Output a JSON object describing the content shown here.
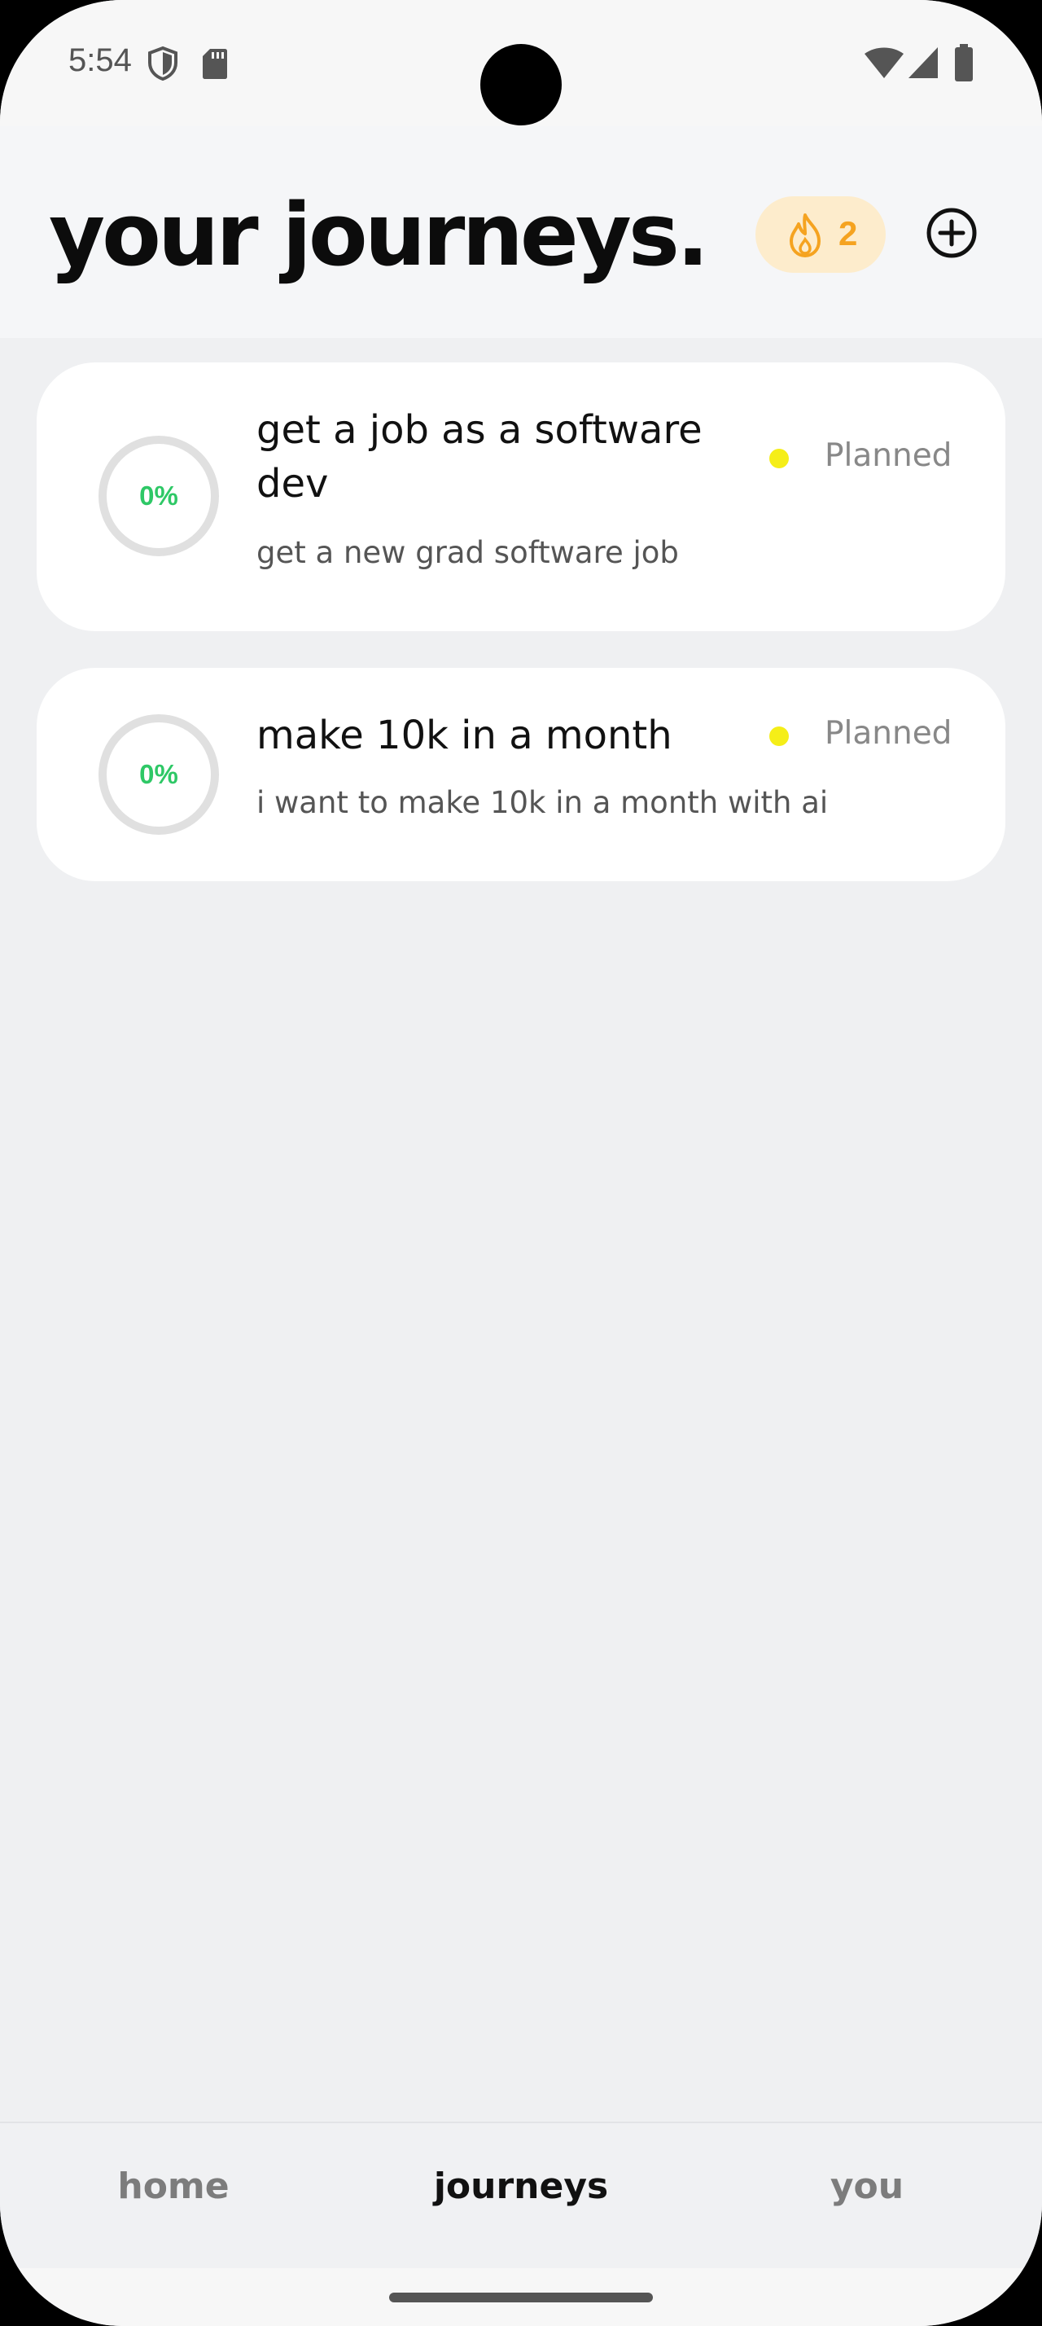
{
  "status_bar": {
    "time": "5:54",
    "icons": [
      "shield-icon",
      "sd-card-icon",
      "wifi-icon",
      "cell-signal-icon",
      "battery-icon"
    ]
  },
  "header": {
    "title": "your journeys.",
    "streak": {
      "icon": "flame-icon",
      "count": "2"
    },
    "add_icon": "plus-circle-icon"
  },
  "journeys": [
    {
      "progress_label": "0%",
      "progress": 0,
      "title": "get a job as a software dev",
      "description": "get a new grad software job",
      "status": "Planned"
    },
    {
      "progress_label": "0%",
      "progress": 0,
      "title": "make 10k in a month",
      "description": "i want to make 10k in a month with ai",
      "status": "Planned"
    }
  ],
  "bottom_nav": {
    "items": [
      {
        "label": "home",
        "active": false
      },
      {
        "label": "journeys",
        "active": true
      },
      {
        "label": "you",
        "active": false
      }
    ]
  },
  "colors": {
    "accent_green": "#2ec866",
    "status_yellow": "#f5ee18",
    "streak_orange": "#f5a320",
    "streak_bg": "#fdeccc",
    "page_bg": "#eff0f2"
  }
}
